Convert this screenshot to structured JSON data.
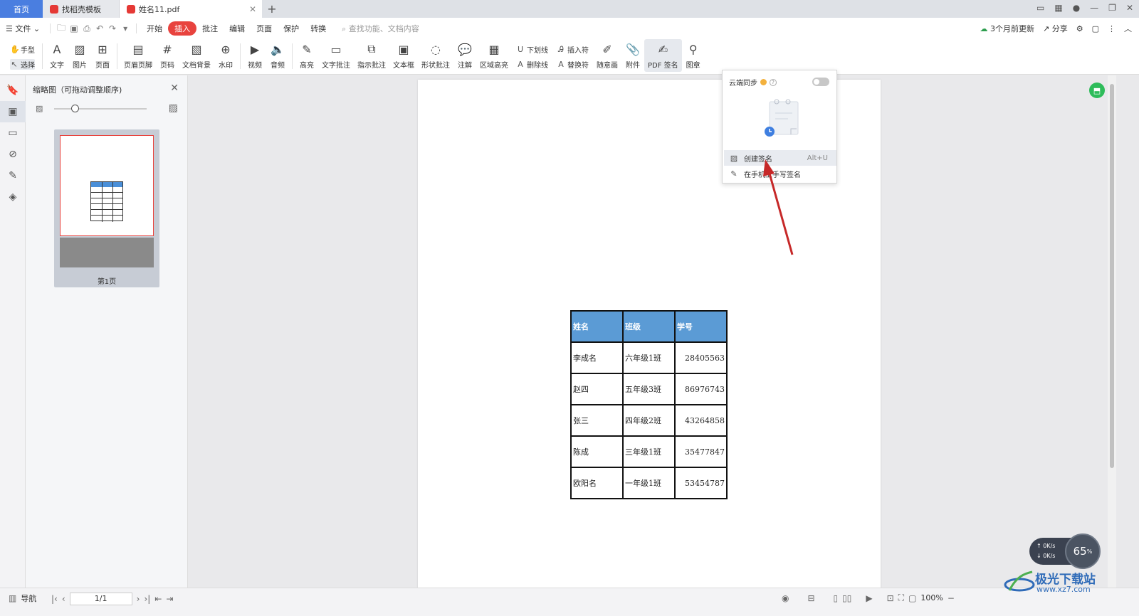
{
  "tabs": {
    "home": "首页",
    "template": "找稻壳模板",
    "document": "姓名11.pdf"
  },
  "menu": {
    "file": "文件",
    "items": [
      "开始",
      "插入",
      "批注",
      "编辑",
      "页面",
      "保护",
      "转换"
    ],
    "search_placeholder": "查找功能、文档内容",
    "update_status": "3个月前更新",
    "share": "分享"
  },
  "ribbon": {
    "hand": "手型",
    "select": "选择",
    "text": "文字",
    "image": "图片",
    "page": "页面",
    "header_footer": "页眉页脚",
    "page_number": "页码",
    "doc_background": "文档背景",
    "watermark": "水印",
    "video": "视频",
    "audio": "音频",
    "highlight": "高亮",
    "text_comment": "文字批注",
    "pointer_comment": "指示批注",
    "textbox": "文本框",
    "shape_comment": "形状批注",
    "annotation": "注解",
    "area_highlight": "区域高亮",
    "underline": "下划线",
    "strikethrough": "删除线",
    "insert_char": "插入符",
    "replace_char": "替换符",
    "freehand": "随意画",
    "attachment": "附件",
    "pdf_sign": "PDF 签名",
    "stamp": "图章"
  },
  "thumbnail_panel": {
    "title": "缩略图（可拖动调整顺序)",
    "page_label": "第1页"
  },
  "table": {
    "headers": [
      "姓名",
      "班级",
      "学号"
    ],
    "rows": [
      [
        "李成名",
        "六年级1班",
        "28405563"
      ],
      [
        "赵四",
        "五年级3班",
        "86976743"
      ],
      [
        "张三",
        "四年级2班",
        "43264858"
      ],
      [
        "陈成",
        "三年级1班",
        "35477847"
      ],
      [
        "欧阳名",
        "一年级1班",
        "53454787"
      ]
    ]
  },
  "dropdown": {
    "cloud_sync": "云端同步",
    "create_signature": "创建签名",
    "create_shortcut": "Alt+U",
    "phone_signature": "在手机上手写签名"
  },
  "statusbar": {
    "nav": "导航",
    "page_indicator": "1/1",
    "zoom": "100%"
  },
  "overlays": {
    "net_up": "0K/s",
    "net_down": "0K/s",
    "cpu": "65",
    "cpu_unit": "%",
    "watermark_title": "极光下载站",
    "watermark_url": "www.xz7.com"
  },
  "colors": {
    "accent_red": "#e8433e",
    "tab_blue": "#4a7ee0",
    "table_header": "#5b9bd5",
    "arrow": "#c62828"
  }
}
